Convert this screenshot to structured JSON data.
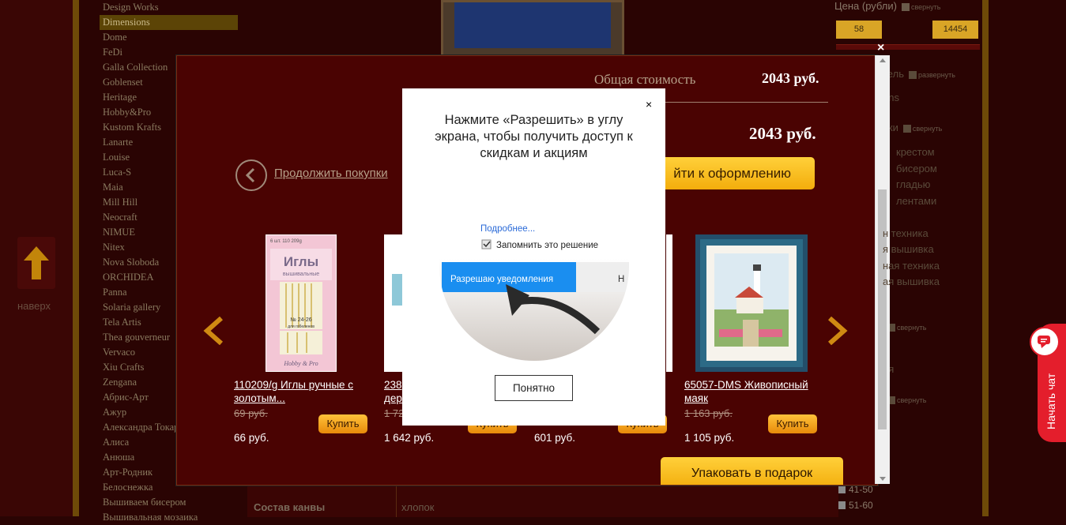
{
  "brands": [
    "Design Works",
    "Dimensions",
    "Dome",
    "FeDi",
    "Galla Collection",
    "Goblenset",
    "Heritage",
    "Hobby&Pro",
    "Kustom Krafts",
    "Lanarte",
    "Louise",
    "Luca-S",
    "Maia",
    "Mill Hill",
    "Neocraft",
    "NIMUE",
    "Nitex",
    "Nova Sloboda",
    "ORCHIDEA",
    "Panna",
    "Solaria gallery",
    "Tela Artis",
    "Thea gouverneur",
    "Vervaco",
    "Xiu Crafts",
    "Zengana",
    "Абрис-Арт",
    "Ажур",
    "Александра Токарева",
    "Алиса",
    "Анюша",
    "Арт-Родник",
    "Белоснежка",
    "Вышиваем бисером",
    "Вышивальная мозаика"
  ],
  "up_label": "наверх",
  "filter": {
    "price_title": "Цена (рубли)",
    "collapse": "свернуть",
    "expand": "развернуть",
    "price_min": "58",
    "price_max": "14454",
    "maker_partial": "тель",
    "maker_item": "ons",
    "kind_partial": "вки",
    "kinds": [
      "крестом",
      "бисером",
      "гладью",
      "лентами",
      "",
      "н техника",
      "я вышивка",
      "ная техника",
      "ая вышивка"
    ],
    "other_partial": "ая",
    "ages": [
      "41-50",
      "51-60"
    ]
  },
  "bg_bottom": {
    "label": "Состав канвы",
    "value": "хлопок"
  },
  "chat": {
    "label": "Начать чат"
  },
  "cart": {
    "close": "×",
    "total_label": "Общая стоимость",
    "total_value": "2043 руб.",
    "total_value2": "2043 руб.",
    "continue": "Продолжить покупки",
    "checkout": "йти к оформлению",
    "gift": "Упаковать в подарок",
    "buy": "Купить",
    "products": [
      {
        "title": "110209/g Иглы ручные с золотым...",
        "old": "69 руб.",
        "price": "66 руб.",
        "pkg_code": "6 шт.   110 209g",
        "pkg_title": "Иглы",
        "pkg_sub": "вышивальные",
        "pkg_num": "№ 24-26",
        "pkg_for": "для гобеленов",
        "pkg_brand": "Hobby & Pro"
      },
      {
        "title": "238",
        "title2": "дер",
        "old": "1 72",
        "price": "1 642 руб."
      },
      {
        "title": "",
        "old": "",
        "price": "601 руб."
      },
      {
        "title": "65057-DMS Живописный маяк",
        "old": "1 163 руб.",
        "price": "1 105 руб."
      }
    ]
  },
  "popup": {
    "close": "×",
    "text": "Нажмите «Разрешить» в углу экрана, чтобы получить доступ к скидкам и акциям",
    "more": "Подробнее...",
    "remember": "Запомнить это решение",
    "allow": "Разрешаю уведомления",
    "other": "Н",
    "ok": "Понятно"
  },
  "colors": {
    "accent": "#f3ad0c",
    "modal_bg": "#4a0302",
    "chat": "#e41e2c",
    "allow_blue": "#1a8ef0"
  }
}
